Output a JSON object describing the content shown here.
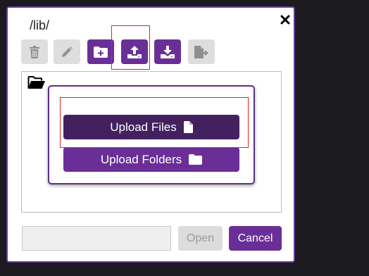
{
  "dialog": {
    "path": "/lib/",
    "close_icon": "close-x-icon"
  },
  "toolbar": {
    "buttons": [
      {
        "name": "delete",
        "icon": "trash-icon",
        "state": "disabled"
      },
      {
        "name": "rename",
        "icon": "pencil-icon",
        "state": "disabled"
      },
      {
        "name": "new-folder",
        "icon": "folder-plus-icon",
        "state": "enabled"
      },
      {
        "name": "upload",
        "icon": "upload-icon",
        "state": "enabled"
      },
      {
        "name": "download",
        "icon": "download-icon",
        "state": "enabled"
      },
      {
        "name": "move",
        "icon": "file-export-icon",
        "state": "disabled"
      }
    ]
  },
  "file_pane": {
    "entry_icon": "open-folder-icon"
  },
  "upload_menu": {
    "files_label": "Upload Files",
    "folders_label": "Upload Folders"
  },
  "footer": {
    "filename_value": "",
    "open_label": "Open",
    "cancel_label": "Cancel"
  },
  "colors": {
    "accent": "#6a2f97",
    "accent_dark": "#43215e",
    "highlight": "#e02424",
    "disabled": "#dedede",
    "background": "#1b1a1e"
  }
}
